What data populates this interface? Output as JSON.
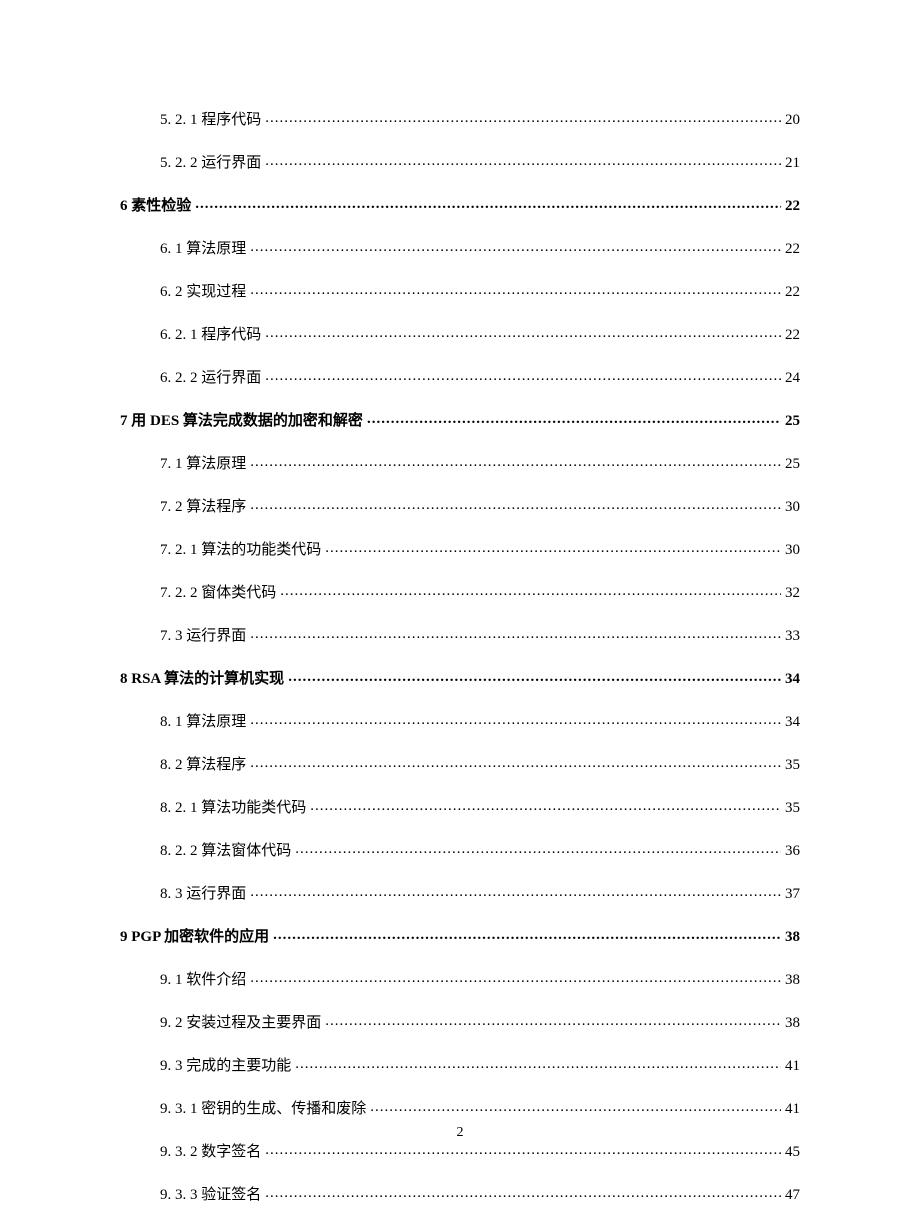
{
  "page_number": "2",
  "toc": [
    {
      "level": 3,
      "label": "5. 2. 1 程序代码",
      "page": "20"
    },
    {
      "level": 3,
      "label": "5. 2. 2 运行界面",
      "page": "21"
    },
    {
      "level": 1,
      "label": "6 素性检验",
      "page": "22"
    },
    {
      "level": 2,
      "label": "6. 1 算法原理",
      "page": "22"
    },
    {
      "level": 2,
      "label": "6. 2 实现过程",
      "page": "22"
    },
    {
      "level": 3,
      "label": "6. 2. 1 程序代码",
      "page": "22"
    },
    {
      "level": 3,
      "label": "6. 2. 2 运行界面",
      "page": "24"
    },
    {
      "level": 1,
      "label": "7 用 DES 算法完成数据的加密和解密",
      "page": "25"
    },
    {
      "level": 2,
      "label": "7. 1 算法原理",
      "page": "25"
    },
    {
      "level": 2,
      "label": "7. 2 算法程序",
      "page": "30"
    },
    {
      "level": 3,
      "label": "7. 2. 1  算法的功能类代码",
      "page": "30"
    },
    {
      "level": 3,
      "label": "7. 2. 2  窗体类代码",
      "page": "32"
    },
    {
      "level": 2,
      "label": "7. 3 运行界面",
      "page": "33"
    },
    {
      "level": 1,
      "label": "8 RSA 算法的计算机实现",
      "page": "34"
    },
    {
      "level": 2,
      "label": "8. 1 算法原理",
      "page": "34"
    },
    {
      "level": 2,
      "label": "8. 2 算法程序",
      "page": "35"
    },
    {
      "level": 3,
      "label": "8. 2. 1  算法功能类代码",
      "page": "35"
    },
    {
      "level": 3,
      "label": "8. 2. 2  算法窗体代码",
      "page": "36"
    },
    {
      "level": 2,
      "label": "8. 3 运行界面",
      "page": "37"
    },
    {
      "level": 1,
      "label": "9 PGP 加密软件的应用",
      "page": "38"
    },
    {
      "level": 2,
      "label": "9. 1 软件介绍",
      "page": "38"
    },
    {
      "level": 2,
      "label": "9. 2 安装过程及主要界面",
      "page": "38"
    },
    {
      "level": 2,
      "label": "9. 3 完成的主要功能",
      "page": "41"
    },
    {
      "level": 3,
      "label": "9. 3. 1 密钥的生成、传播和废除",
      "page": "41"
    },
    {
      "level": 3,
      "label": "9. 3. 2 数字签名",
      "page": "45"
    },
    {
      "level": 3,
      "label": "9. 3. 3 验证签名",
      "page": "47"
    }
  ]
}
